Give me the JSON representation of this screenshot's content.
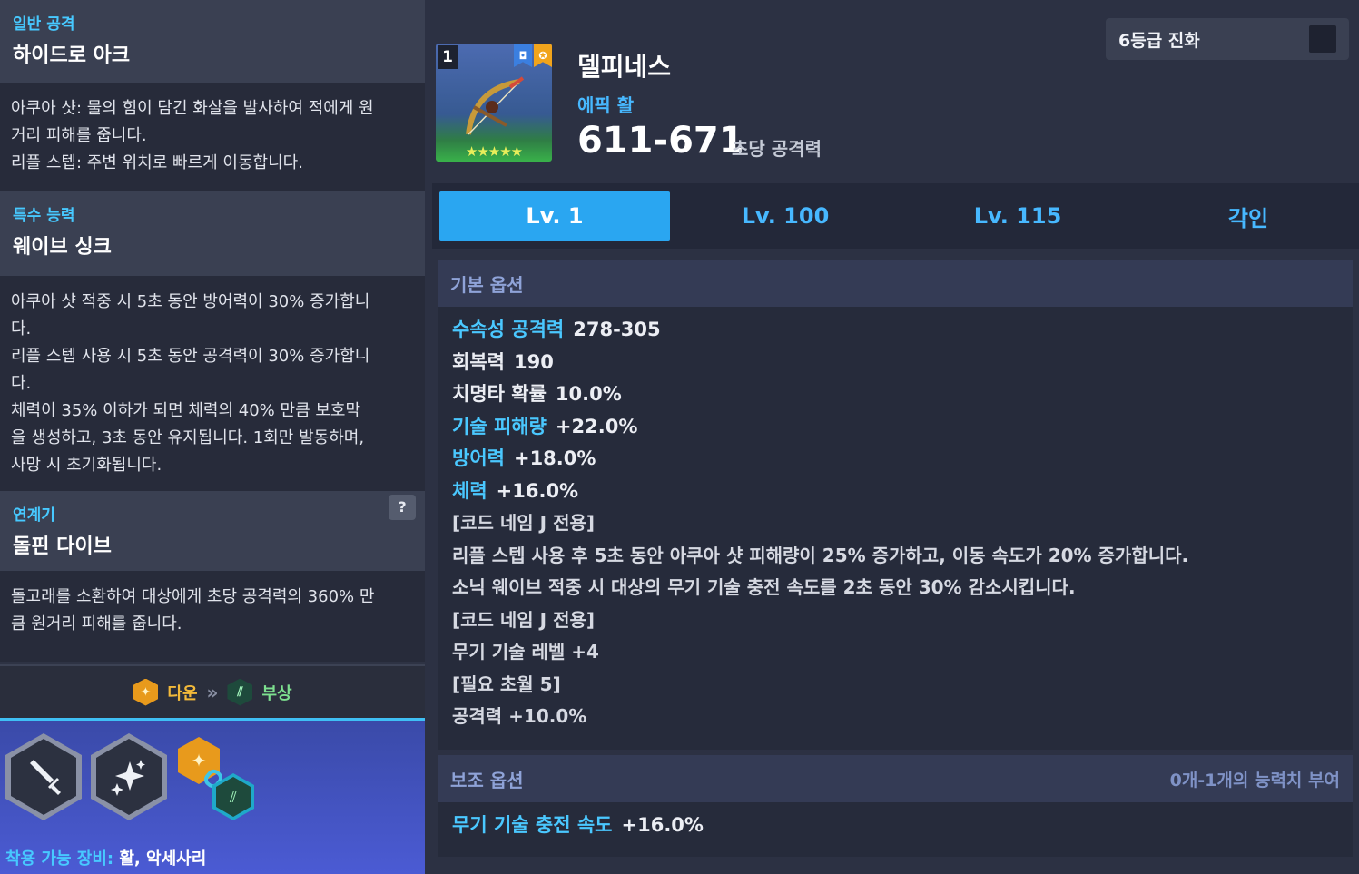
{
  "left": {
    "normal_attack": {
      "category": "일반 공격",
      "title": "하이드로 아크",
      "lines": [
        "아쿠아 샷: 물의 힘이 담긴 화살을 발사하여 적에게 원",
        "거리 피해를 줍니다.",
        "리플 스텝: 주변 위치로 빠르게 이동합니다."
      ]
    },
    "special_ability": {
      "category": "특수 능력",
      "title": "웨이브 싱크",
      "lines": [
        "아쿠아 샷 적중 시 5초 동안 방어력이 30% 증가합니",
        "다.",
        "리플 스텝 사용 시 5초 동안 공격력이 30% 증가합니",
        "다.",
        "체력이 35% 이하가 되면 체력의 40% 만큼 보호막",
        "을 생성하고, 3초 동안 유지됩니다. 1회만 발동하며,",
        "사망 시 초기화됩니다."
      ]
    },
    "chain_skill": {
      "category": "연계기",
      "title": "돌핀 다이브",
      "help": "?",
      "lines": [
        "돌고래를 소환하여 대상에게 초당 공격력의 360% 만",
        "큼 원거리 피해를 줍니다."
      ]
    },
    "combo": {
      "from": "다운",
      "arrow": "»",
      "to": "부상"
    },
    "equip": {
      "label": "착용 가능 장비:",
      "value": "활, 악세사리"
    }
  },
  "item": {
    "level_number": "1",
    "name": "델피네스",
    "grade": "에픽 활",
    "attack": "611-671",
    "attack_label": "초당 공격력",
    "stars": "★★★★★",
    "evolution_label": "6등급 진화"
  },
  "tabs": [
    {
      "label": "Lv. 1",
      "active": true
    },
    {
      "label": "Lv. 100",
      "active": false
    },
    {
      "label": "Lv. 115",
      "active": false
    },
    {
      "label": "각인",
      "active": false
    }
  ],
  "basic_options": {
    "header": "기본 옵션",
    "stats": [
      {
        "key": "수속성 공격력",
        "value": "278-305",
        "highlight": true
      },
      {
        "key": "회복력",
        "value": "190",
        "highlight": false
      },
      {
        "key": "치명타 확률",
        "value": "10.0%",
        "highlight": false
      },
      {
        "key": "기술 피해량",
        "value": "+22.0%",
        "highlight": true
      },
      {
        "key": "방어력",
        "value": "+18.0%",
        "highlight": true
      },
      {
        "key": "체력",
        "value": "+16.0%",
        "highlight": true
      }
    ],
    "descriptions": [
      "[코드 네임 J 전용]",
      "리플 스텝 사용 후 5초 동안 아쿠아 샷 피해량이 25% 증가하고, 이동 속도가 20% 증가합니다.",
      "소닉 웨이브 적중 시 대상의 무기 기술 충전 속도를 2초 동안 30% 감소시킵니다.",
      "[코드 네임 J 전용]",
      "무기 기술 레벨 +4",
      "[필요 초월 5]",
      "공격력 +10.0%"
    ]
  },
  "sub_options": {
    "header": "보조 옵션",
    "note": "0개-1개의 능력치 부여",
    "stat_key": "무기 기술 충전 속도",
    "stat_value": "+16.0%"
  },
  "colors": {
    "accent_cyan": "#47c9ff",
    "tab_active": "#2aa6f1",
    "combo_down": "#f2b93a",
    "combo_injury": "#7de08f"
  }
}
